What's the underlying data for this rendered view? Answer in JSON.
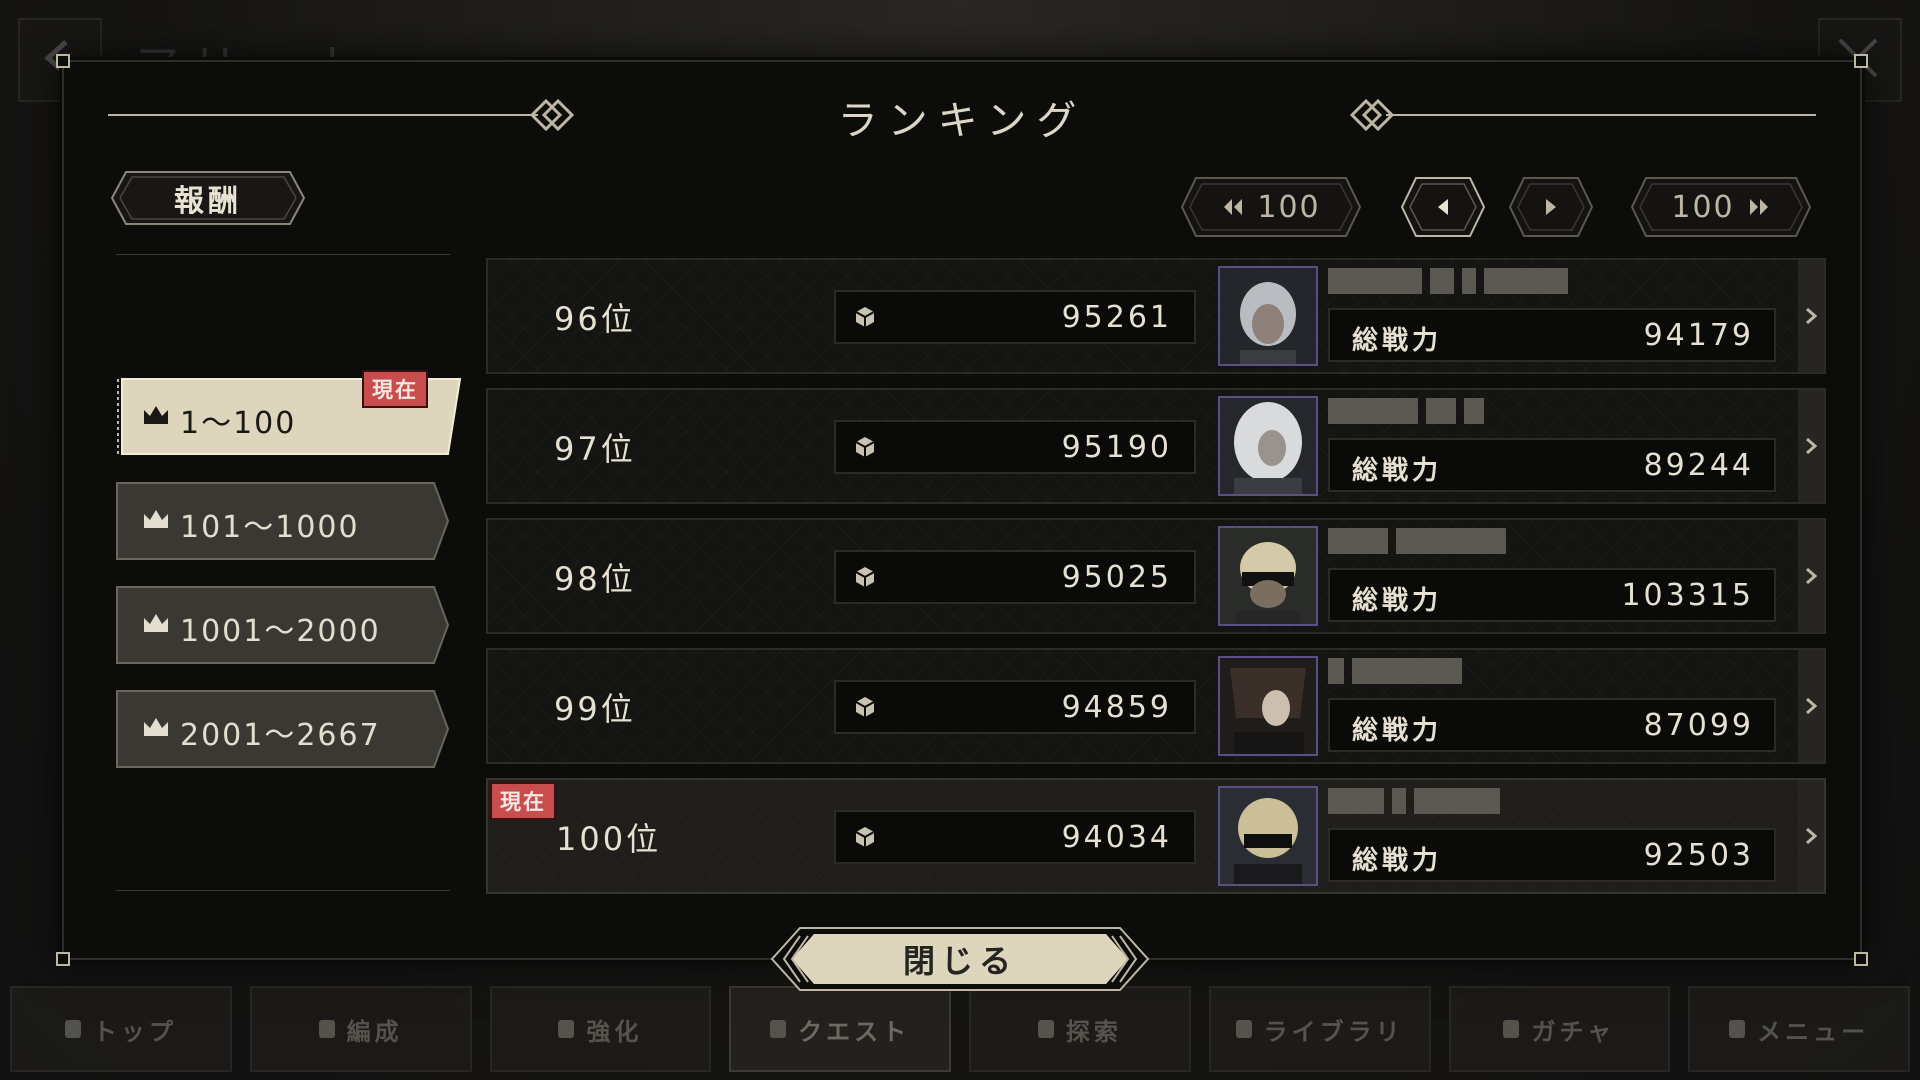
{
  "background": {
    "title": "アリーナ",
    "nav": [
      {
        "label": "トップ",
        "active": false
      },
      {
        "label": "編成",
        "active": false
      },
      {
        "label": "強化",
        "active": false
      },
      {
        "label": "クエスト",
        "active": true
      },
      {
        "label": "探索",
        "active": false
      },
      {
        "label": "ライブラリ",
        "active": false
      },
      {
        "label": "ガチャ",
        "active": false
      },
      {
        "label": "メニュー",
        "active": false
      }
    ]
  },
  "modal": {
    "title": "ランキング",
    "reward_label": "報酬",
    "pager": {
      "back100": "100",
      "fwd100": "100"
    },
    "current_badge": "現在",
    "tiers": [
      {
        "label": "1～100",
        "active": true
      },
      {
        "label": "101～1000",
        "active": false
      },
      {
        "label": "1001～2000",
        "active": false
      },
      {
        "label": "2001～2667",
        "active": false
      }
    ],
    "power_label": "総戦力",
    "rows": [
      {
        "rank": "96位",
        "score": "95261",
        "power": "94179",
        "me": false
      },
      {
        "rank": "97位",
        "score": "95190",
        "power": "89244",
        "me": false
      },
      {
        "rank": "98位",
        "score": "95025",
        "power": "103315",
        "me": false
      },
      {
        "rank": "99位",
        "score": "94859",
        "power": "87099",
        "me": false
      },
      {
        "rank": "100位",
        "score": "94034",
        "power": "92503",
        "me": true
      }
    ],
    "close_label": "閉じる"
  },
  "colors": {
    "accent": "#bdb6a5",
    "active_tier": "#ddd6bd",
    "badge": "#c84d4d",
    "avatar_border": "#5a4f86"
  }
}
